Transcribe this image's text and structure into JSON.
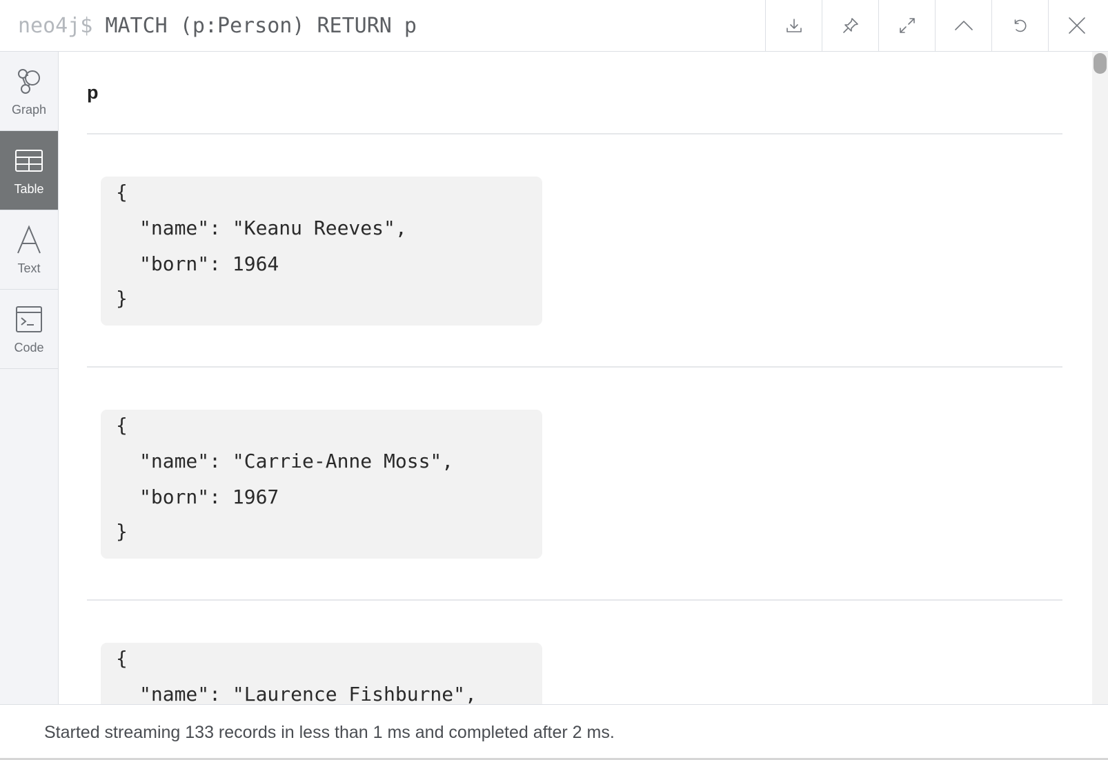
{
  "header": {
    "prompt": "neo4j$",
    "query": "MATCH (p:Person) RETURN p",
    "buttons": [
      "download-icon",
      "pin-icon",
      "expand-icon",
      "chevron-up-icon",
      "refresh-icon",
      "close-icon"
    ]
  },
  "sidebar": {
    "items": [
      {
        "label": "Graph",
        "icon": "graph-icon",
        "active": false
      },
      {
        "label": "Table",
        "icon": "table-icon",
        "active": true
      },
      {
        "label": "Text",
        "icon": "text-icon",
        "active": false
      },
      {
        "label": "Code",
        "icon": "code-icon",
        "active": false
      }
    ]
  },
  "table": {
    "column": "p",
    "records": [
      {
        "open": "{",
        "name_line": "\"name\": \"Keanu Reeves\",",
        "born_line": "\"born\": 1964",
        "close": "}"
      },
      {
        "open": "{",
        "name_line": "\"name\": \"Carrie-Anne Moss\",",
        "born_line": "\"born\": 1967",
        "close": "}"
      },
      {
        "open": "{",
        "name_line": "\"name\": \"Laurence Fishburne\","
      }
    ]
  },
  "status": "Started streaming 133 records in less than 1 ms and completed after 2 ms.",
  "colors": {
    "sidebar_bg": "#f3f4f7",
    "active_tab": "#727577",
    "card_bg": "#f2f2f2",
    "prompt": "#b4b8bd"
  }
}
